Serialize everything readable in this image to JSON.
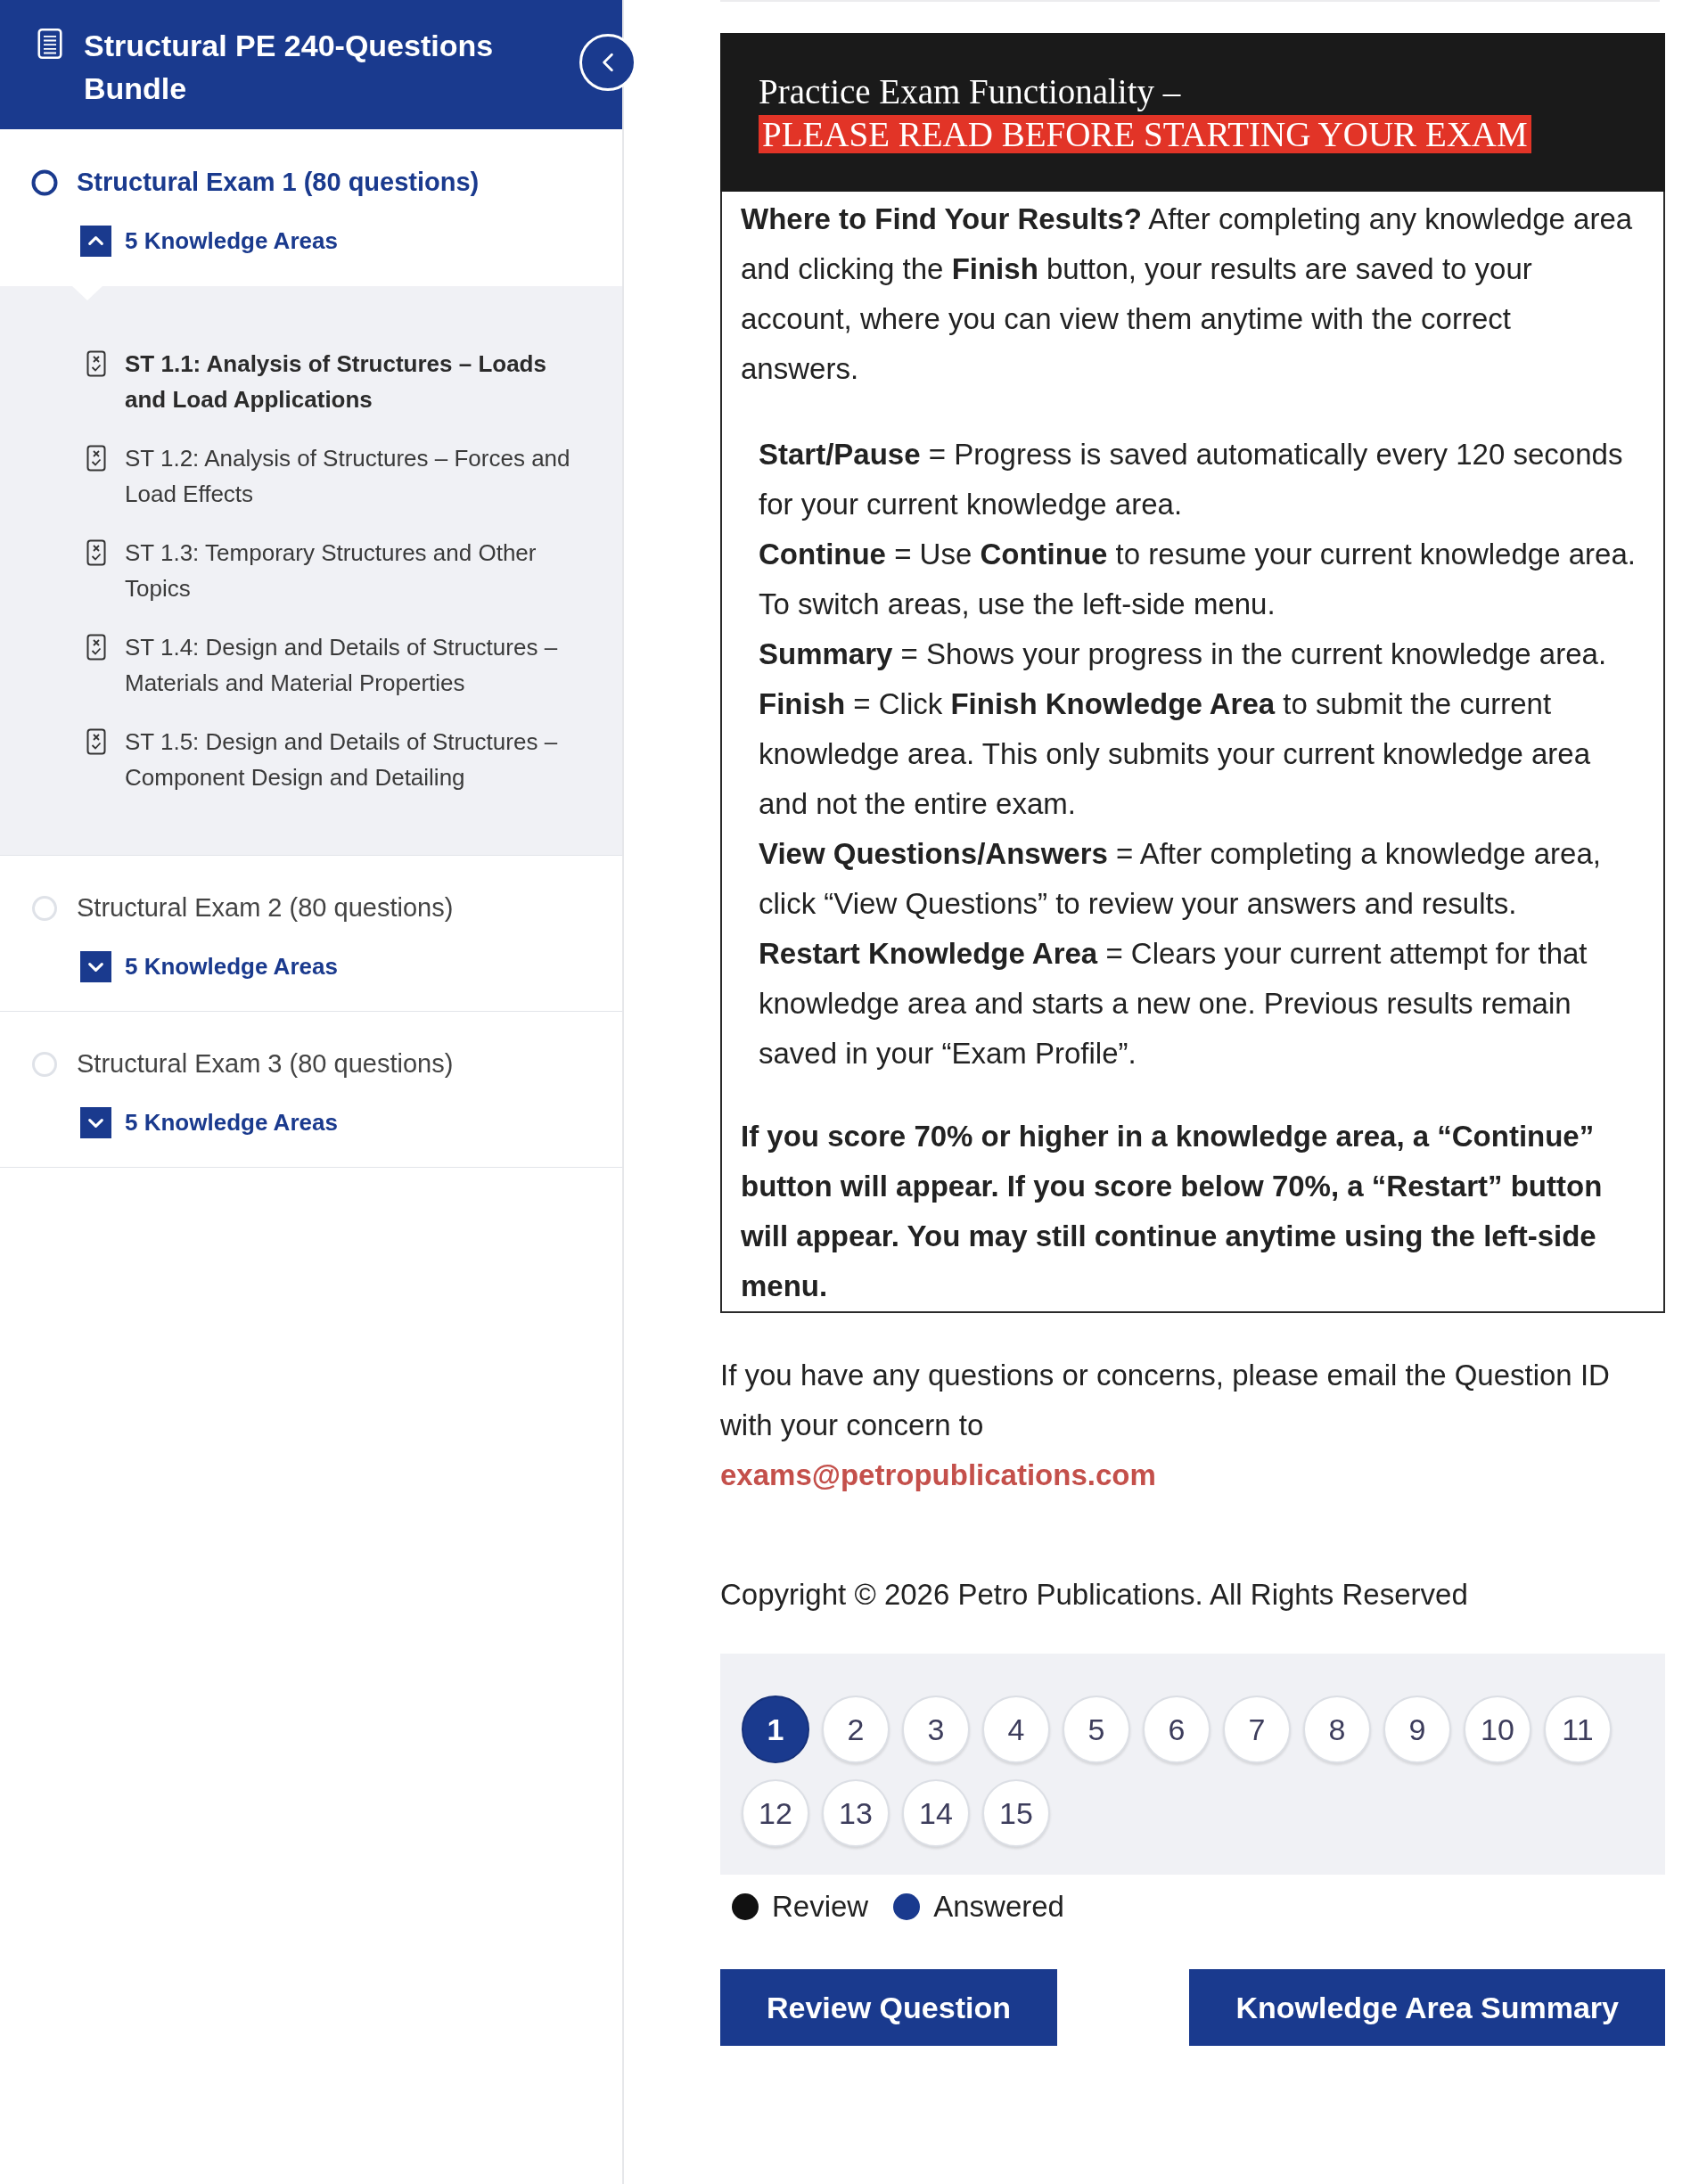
{
  "sidebar": {
    "title": "Structural PE 240-Questions Bundle",
    "exams": [
      {
        "title": "Structural Exam 1 (80 questions)",
        "selected": true,
        "areas": {
          "label": "5 Knowledge Areas",
          "expanded": true,
          "items": [
            {
              "label": "ST 1.1: Analysis of Structures – Loads and Load Applications",
              "selected": true
            },
            {
              "label": "ST 1.2: Analysis of Structures – Forces and Load Effects",
              "selected": false
            },
            {
              "label": "ST 1.3: Temporary Structures and Other Topics",
              "selected": false
            },
            {
              "label": "ST 1.4: Design and Details of Structures – Materials and Material Properties",
              "selected": false
            },
            {
              "label": "ST 1.5: Design and Details of Structures – Component Design and Detailing",
              "selected": false
            }
          ]
        }
      },
      {
        "title": "Structural Exam 2 (80 questions)",
        "selected": false,
        "areas": {
          "label": "5 Knowledge Areas",
          "expanded": false
        }
      },
      {
        "title": "Structural Exam 3 (80 questions)",
        "selected": false,
        "areas": {
          "label": "5 Knowledge Areas",
          "expanded": false
        }
      }
    ]
  },
  "notice": {
    "heading": "Practice Exam Functionality –",
    "highlight": "PLEASE READ BEFORE STARTING YOUR EXAM",
    "intro": "**Where to Find Your Results?** After completing any knowledge area and clicking the **Finish** button, your results are saved to your account, where you can view them anytime with the correct answers.",
    "definitions": [
      "**Start/Pause** = Progress is saved automatically every 120 seconds for your current knowledge area.",
      "**Continue** = Use **Continue** to resume your current knowledge area. To switch areas, use the left-side menu.",
      "**Summary** = Shows your progress in the current knowledge area.",
      "**Finish** = Click **Finish Knowledge Area** to submit the current knowledge area. This only submits your current knowledge area and not the entire exam.",
      "**View Questions/Answers** = After completing a knowledge area, click “View Questions” to review your answers and results.",
      "**Restart Knowledge Area** = Clears your current attempt for that knowledge area and starts a new one. Previous results remain saved in your “Exam Profile”."
    ],
    "note": "If you score 70% or higher in a knowledge area, a “Continue” button will appear. If you score below 70%, a “Restart” button will appear. You may still continue anytime using the left-side menu."
  },
  "contact": {
    "text": "If you have any questions or concerns, please email the Question ID with your concern to",
    "email": "exams@petropublications.com"
  },
  "copyright": "Copyright © 2026 Petro Publications. All Rights Reserved",
  "question_nav": {
    "questions": [
      {
        "label": "1",
        "selected": true
      },
      {
        "label": "2",
        "selected": false
      },
      {
        "label": "3",
        "selected": false
      },
      {
        "label": "4",
        "selected": false
      },
      {
        "label": "5",
        "selected": false
      },
      {
        "label": "6",
        "selected": false
      },
      {
        "label": "7",
        "selected": false
      },
      {
        "label": "8",
        "selected": false
      },
      {
        "label": "9",
        "selected": false
      },
      {
        "label": "10",
        "selected": false
      },
      {
        "label": "11",
        "selected": false
      },
      {
        "label": "12",
        "selected": false
      },
      {
        "label": "13",
        "selected": false
      },
      {
        "label": "14",
        "selected": false
      },
      {
        "label": "15",
        "selected": false
      }
    ],
    "legend": [
      {
        "label": "Review",
        "color": "#111111"
      },
      {
        "label": "Answered",
        "color": "#1a3a8e"
      }
    ]
  },
  "buttons": [
    "Review Question",
    "Knowledge Area Summary"
  ]
}
